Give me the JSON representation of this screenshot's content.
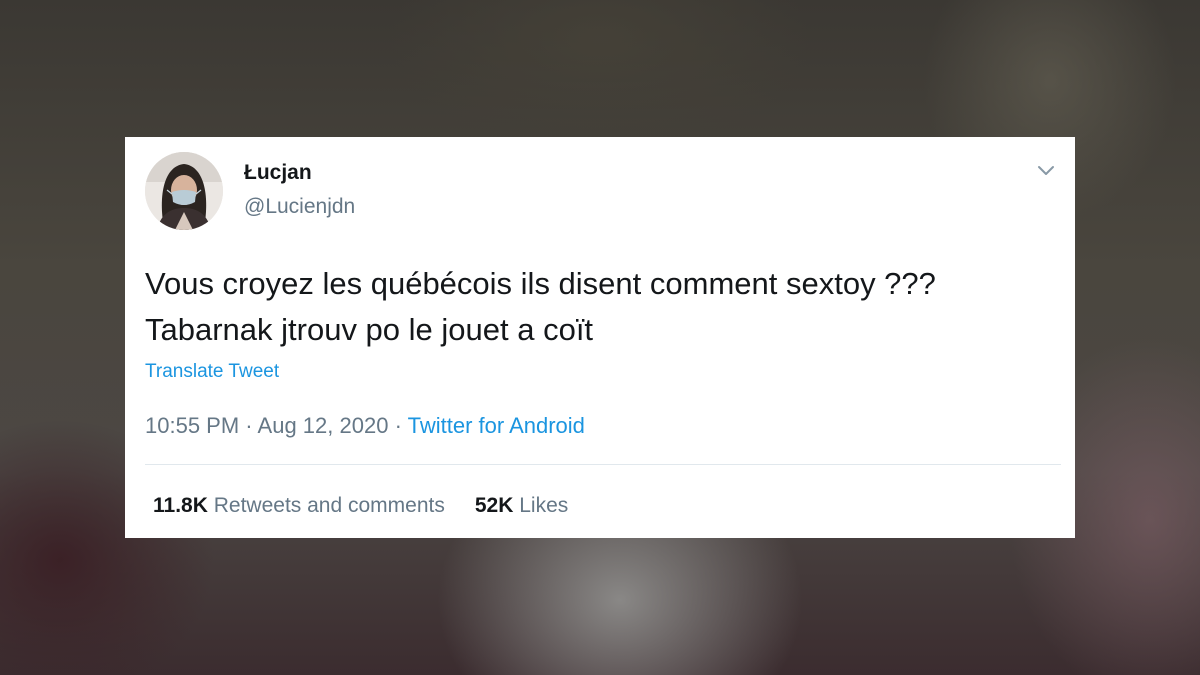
{
  "tweet": {
    "display_name": "Łucjan",
    "handle": "@Lucienjdn",
    "text_lines": [
      "Vous croyez les québécois ils disent comment sextoy ???",
      "Tabarnak jtrouv po le jouet a coït"
    ],
    "translate_label": "Translate Tweet",
    "time": "10:55 PM",
    "separator": "·",
    "date": "Aug 12, 2020",
    "source": "Twitter for Android",
    "retweets_count": "11.8K",
    "retweets_label": "Retweets and comments",
    "likes_count": "52K",
    "likes_label": "Likes"
  },
  "icons": {
    "menu": "chevron-down-icon",
    "avatar": "profile-photo"
  },
  "colors": {
    "link": "#1b95e0",
    "secondary_text": "#657786",
    "primary_text": "#14171a",
    "card_bg": "#ffffff"
  }
}
